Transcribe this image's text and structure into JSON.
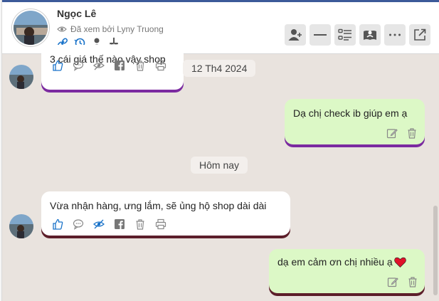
{
  "header": {
    "name": "Ngọc Lê",
    "seen_text": "Đã xem bởi Lyny Truong",
    "quick_icons": [
      "link-icon",
      "history-icon",
      "user-icon",
      "cake-icon"
    ],
    "buttons": [
      "add-user-icon",
      "minimize-icon",
      "list-icon",
      "inbox-icon",
      "more-icon",
      "popout-icon"
    ]
  },
  "messages": [
    {
      "from": "customer",
      "text": "3 cái giá thế nào vậy shop",
      "underline_color": "#7b2aa0"
    },
    {
      "from": "shop",
      "text": "Dạ chị check ib giúp em ạ",
      "underline_color": "#7b2aa0"
    },
    {
      "from": "customer",
      "text": "Vừa nhận hàng, ưng lắm, sẽ ủng hộ shop dài dài",
      "underline_color": "#5c1e2a"
    },
    {
      "from": "shop",
      "text": "dạ em cảm ơn chị nhiều ạ",
      "underline_color": "#5c1e2a"
    }
  ],
  "dates": {
    "first": "12 Th4 2024",
    "today": "Hôm nay"
  },
  "colors": {
    "header_accent": "#3c5a99",
    "icon_blue": "#1a73c9",
    "bubble_out": "#dcf8c6",
    "chat_bg": "#e9e3de"
  }
}
